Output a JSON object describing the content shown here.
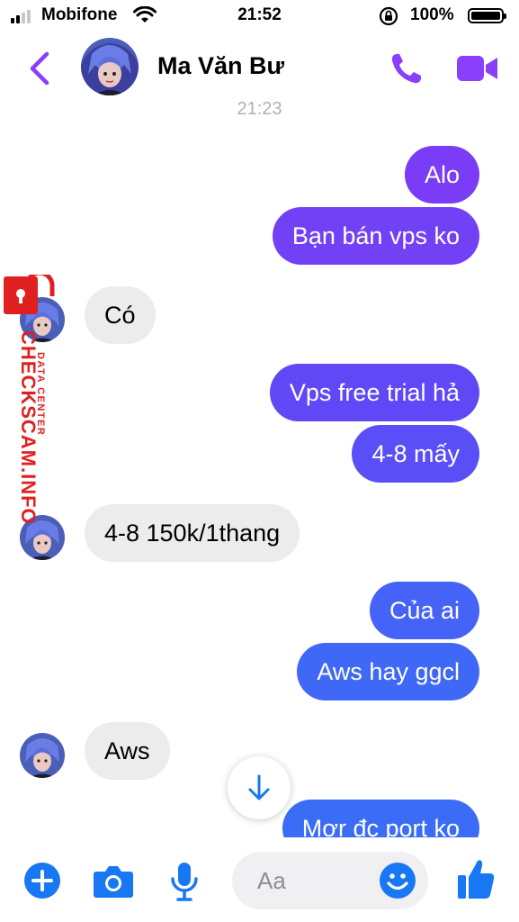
{
  "status_bar": {
    "carrier": "Mobifone",
    "time": "21:52",
    "battery": "100%"
  },
  "header": {
    "back_icon": "chevron-left-icon",
    "contact_name": "Ma Văn Bư",
    "call_icon": "phone-icon",
    "video_icon": "video-camera-icon"
  },
  "chat": {
    "timestamp": "21:23",
    "messages": [
      {
        "from": "me",
        "text": "Alo"
      },
      {
        "from": "me",
        "text": "Bạn bán vps ko"
      },
      {
        "from": "contact",
        "text": "Có"
      },
      {
        "from": "me",
        "text": "Vps free trial hả"
      },
      {
        "from": "me",
        "text": "4-8 mấy"
      },
      {
        "from": "contact",
        "text": "4-8 150k/1thang"
      },
      {
        "from": "me",
        "text": "Của ai"
      },
      {
        "from": "me",
        "text": "Aws hay ggcl"
      },
      {
        "from": "contact",
        "text": "Aws"
      },
      {
        "from": "me",
        "text": "Mơr đc port ko"
      }
    ]
  },
  "watermark": {
    "brand": "CHECKSCAM.INFO",
    "sub": "DATA CENTER"
  },
  "composer": {
    "placeholder": "Aa",
    "icons": [
      "plus-icon",
      "camera-icon",
      "microphone-icon",
      "emoji-icon",
      "thumbs-up-icon"
    ]
  },
  "colors": {
    "accent_purple": "#8a3ffc",
    "bubble_purple": "#7a3cf6",
    "bubble_blue": "#3a6cf6",
    "action_blue": "#1877f2",
    "incoming_bubble": "#ececec",
    "watermark_red": "#e02020"
  }
}
